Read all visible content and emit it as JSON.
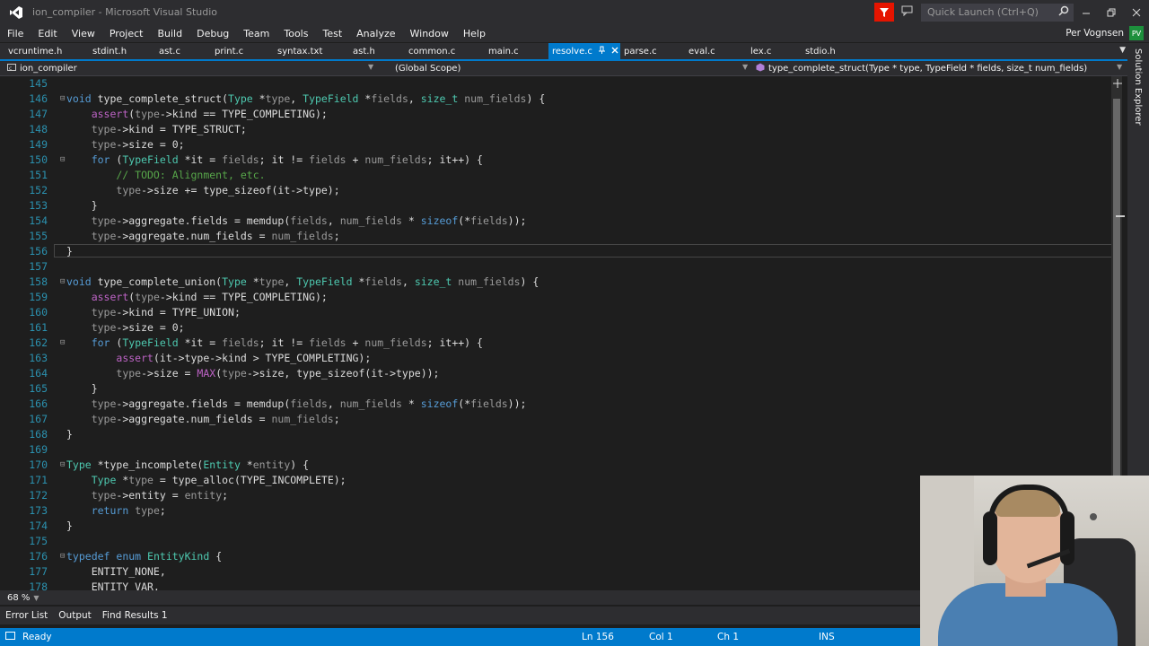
{
  "window": {
    "title": "ion_compiler - Microsoft Visual Studio",
    "quick_launch_placeholder": "Quick Launch (Ctrl+Q)"
  },
  "menu": [
    "File",
    "Edit",
    "View",
    "Project",
    "Build",
    "Debug",
    "Team",
    "Tools",
    "Test",
    "Analyze",
    "Window",
    "Help"
  ],
  "user": {
    "name": "Per Vognsen",
    "initials": "PV"
  },
  "tabs": [
    {
      "label": "vcruntime.h"
    },
    {
      "label": "stdint.h"
    },
    {
      "label": "ast.c"
    },
    {
      "label": "print.c"
    },
    {
      "label": "syntax.txt"
    },
    {
      "label": "ast.h"
    },
    {
      "label": "common.c"
    },
    {
      "label": "main.c"
    },
    {
      "label": "resolve.c",
      "active": true
    },
    {
      "label": "parse.c"
    },
    {
      "label": "eval.c"
    },
    {
      "label": "lex.c"
    },
    {
      "label": "stdio.h"
    }
  ],
  "navbar": {
    "project": "ion_compiler",
    "scope": "(Global Scope)",
    "member": "type_complete_struct(Type * type, TypeField * fields, size_t num_fields)"
  },
  "side_panel_label": "Solution Explorer",
  "editor": {
    "lines": [
      {
        "n": "145",
        "text": ""
      },
      {
        "n": "146",
        "text": "void type_complete_struct(Type *type, TypeField *fields, size_t num_fields) {"
      },
      {
        "n": "147",
        "text": "    assert(type->kind == TYPE_COMPLETING);"
      },
      {
        "n": "148",
        "text": "    type->kind = TYPE_STRUCT;"
      },
      {
        "n": "149",
        "text": "    type->size = 0;"
      },
      {
        "n": "150",
        "text": "    for (TypeField *it = fields; it != fields + num_fields; it++) {"
      },
      {
        "n": "151",
        "text": "        // TODO: Alignment, etc."
      },
      {
        "n": "152",
        "text": "        type->size += type_sizeof(it->type);"
      },
      {
        "n": "153",
        "text": "    }"
      },
      {
        "n": "154",
        "text": "    type->aggregate.fields = memdup(fields, num_fields * sizeof(*fields));"
      },
      {
        "n": "155",
        "text": "    type->aggregate.num_fields = num_fields;"
      },
      {
        "n": "156",
        "text": "}"
      },
      {
        "n": "157",
        "text": ""
      },
      {
        "n": "158",
        "text": "void type_complete_union(Type *type, TypeField *fields, size_t num_fields) {"
      },
      {
        "n": "159",
        "text": "    assert(type->kind == TYPE_COMPLETING);"
      },
      {
        "n": "160",
        "text": "    type->kind = TYPE_UNION;"
      },
      {
        "n": "161",
        "text": "    type->size = 0;"
      },
      {
        "n": "162",
        "text": "    for (TypeField *it = fields; it != fields + num_fields; it++) {"
      },
      {
        "n": "163",
        "text": "        assert(it->type->kind > TYPE_COMPLETING);"
      },
      {
        "n": "164",
        "text": "        type->size = MAX(type->size, type_sizeof(it->type));"
      },
      {
        "n": "165",
        "text": "    }"
      },
      {
        "n": "166",
        "text": "    type->aggregate.fields = memdup(fields, num_fields * sizeof(*fields));"
      },
      {
        "n": "167",
        "text": "    type->aggregate.num_fields = num_fields;"
      },
      {
        "n": "168",
        "text": "}"
      },
      {
        "n": "169",
        "text": ""
      },
      {
        "n": "170",
        "text": "Type *type_incomplete(Entity *entity) {"
      },
      {
        "n": "171",
        "text": "    Type *type = type_alloc(TYPE_INCOMPLETE);"
      },
      {
        "n": "172",
        "text": "    type->entity = entity;"
      },
      {
        "n": "173",
        "text": "    return type;"
      },
      {
        "n": "174",
        "text": "}"
      },
      {
        "n": "175",
        "text": ""
      },
      {
        "n": "176",
        "text": "typedef enum EntityKind {"
      },
      {
        "n": "177",
        "text": "    ENTITY_NONE,"
      },
      {
        "n": "178",
        "text": "    ENTITY_VAR,"
      }
    ],
    "current_line": "156"
  },
  "zoom": "68 %",
  "output_tabs": [
    "Error List",
    "Output",
    "Find Results 1"
  ],
  "status": {
    "ready": "Ready",
    "ln": "Ln 156",
    "col": "Col 1",
    "ch": "Ch 1",
    "mode": "INS"
  },
  "colors": {
    "accent": "#007acc",
    "keyword": "#569cd6",
    "type": "#4ec9b0",
    "comment": "#57a64a",
    "macro": "#bd63c5",
    "param": "#9a9a9a",
    "line_number": "#2b91af"
  }
}
